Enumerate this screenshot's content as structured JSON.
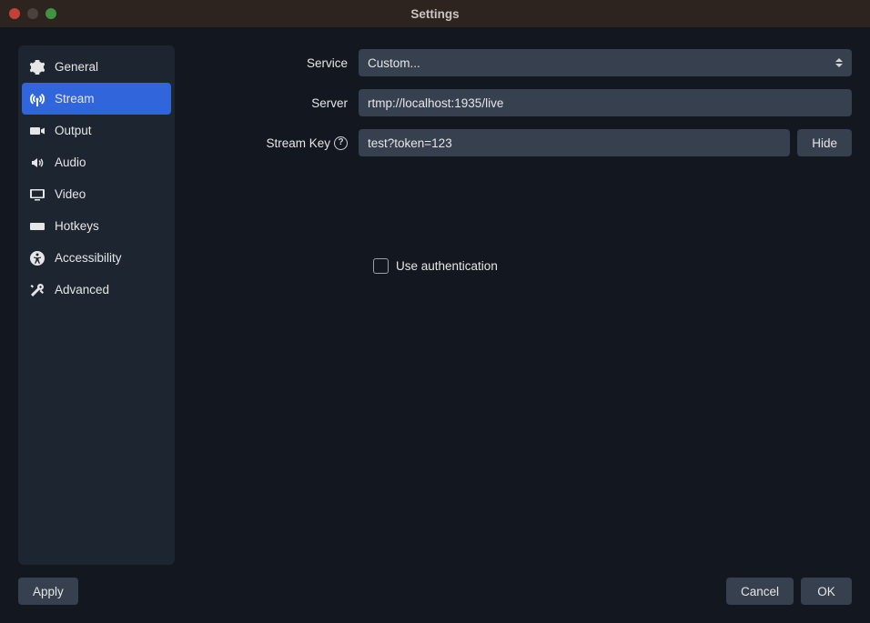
{
  "window": {
    "title": "Settings"
  },
  "sidebar": {
    "items": [
      {
        "label": "General",
        "icon": "gear-icon",
        "selected": false
      },
      {
        "label": "Stream",
        "icon": "antenna-icon",
        "selected": true
      },
      {
        "label": "Output",
        "icon": "camera-export-icon",
        "selected": false
      },
      {
        "label": "Audio",
        "icon": "speaker-icon",
        "selected": false
      },
      {
        "label": "Video",
        "icon": "monitor-icon",
        "selected": false
      },
      {
        "label": "Hotkeys",
        "icon": "keyboard-icon",
        "selected": false
      },
      {
        "label": "Accessibility",
        "icon": "accessibility-icon",
        "selected": false
      },
      {
        "label": "Advanced",
        "icon": "tools-icon",
        "selected": false
      }
    ]
  },
  "form": {
    "service": {
      "label": "Service",
      "value": "Custom..."
    },
    "server": {
      "label": "Server",
      "value": "rtmp://localhost:1935/live"
    },
    "streamKey": {
      "label": "Stream Key",
      "value": "test?token=123",
      "toggleLabel": "Hide"
    },
    "auth": {
      "label": "Use authentication",
      "checked": false
    }
  },
  "footer": {
    "apply": "Apply",
    "cancel": "Cancel",
    "ok": "OK"
  }
}
